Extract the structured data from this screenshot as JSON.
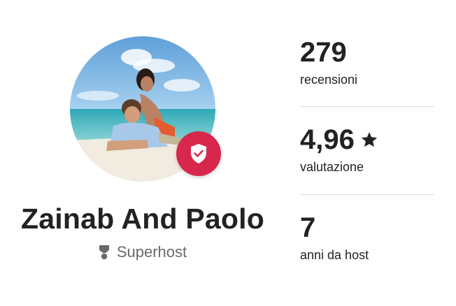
{
  "host": {
    "name": "Zainab And Paolo",
    "badge_label": "Superhost",
    "avatar_icon": "host-photo",
    "verified_icon": "shield-check-icon"
  },
  "stats": [
    {
      "value": "279",
      "label": "recensioni"
    },
    {
      "value": "4,96",
      "label": "valutazione",
      "icon": "star-icon"
    },
    {
      "value": "7",
      "label": "anni da host"
    }
  ],
  "colors": {
    "badge": "#d8274d",
    "text": "#222222",
    "muted": "#6a6a6a",
    "divider": "#dddddd"
  }
}
